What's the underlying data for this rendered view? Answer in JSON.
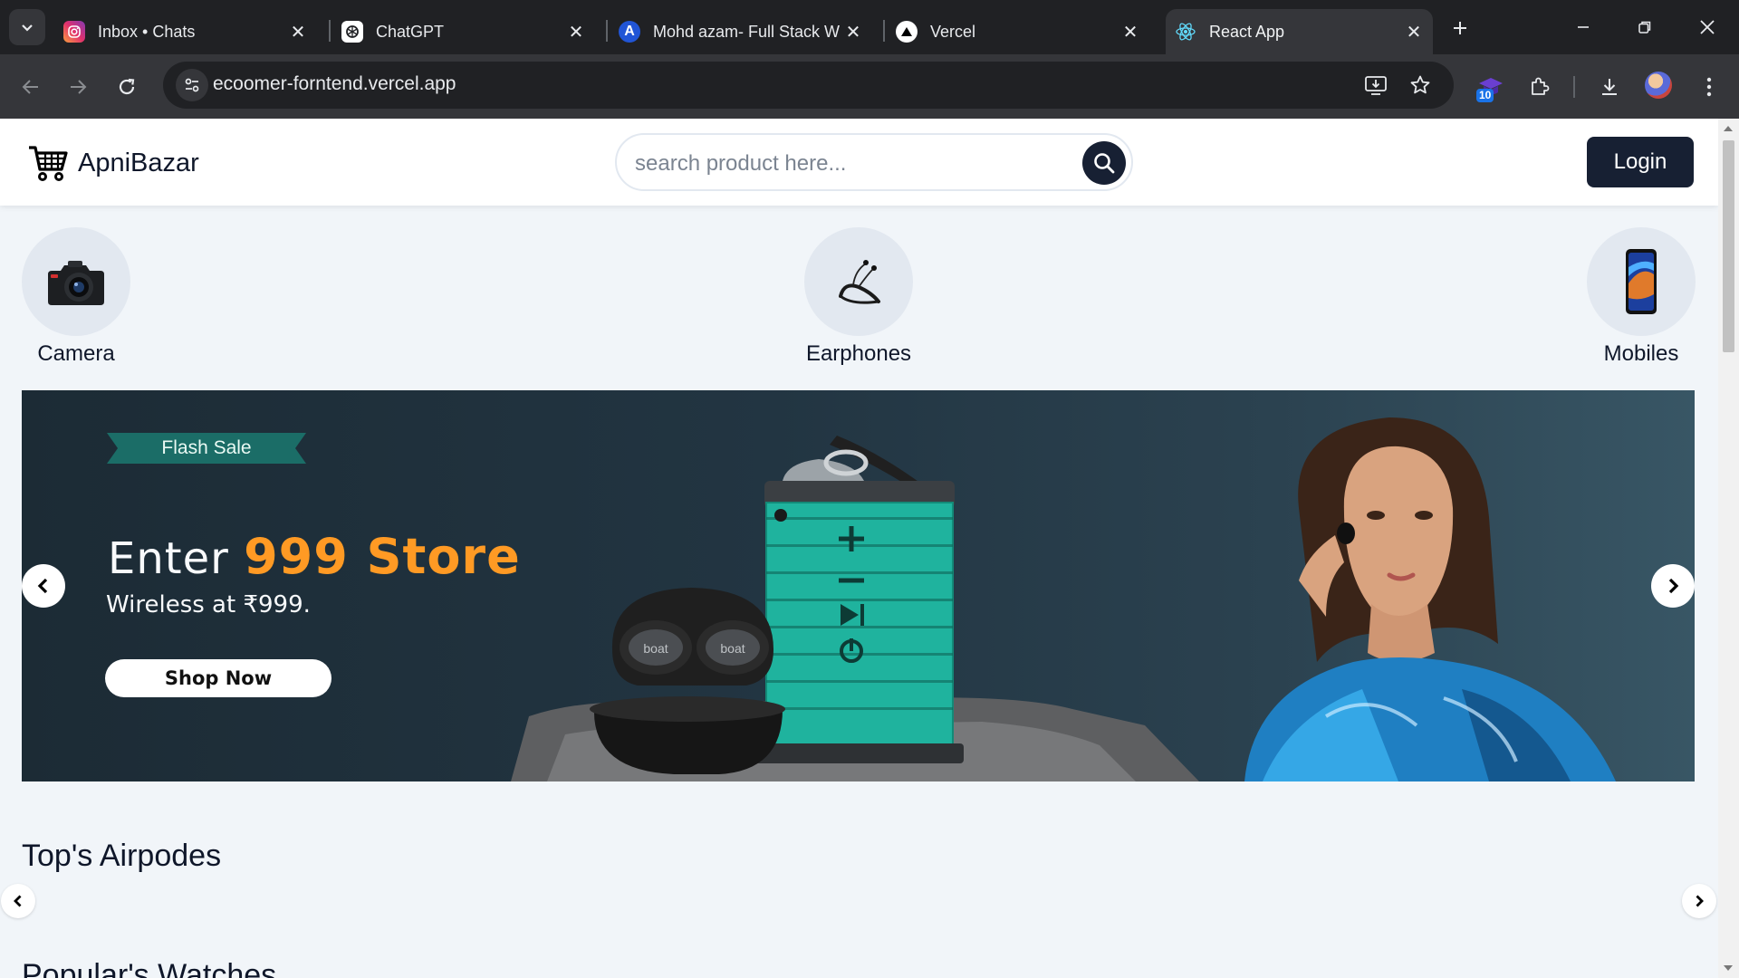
{
  "browser": {
    "tabs": [
      {
        "title": "Inbox • Chats",
        "icon": "instagram-icon"
      },
      {
        "title": "ChatGPT",
        "icon": "chatgpt-icon"
      },
      {
        "title": "Mohd azam- Full Stack W",
        "icon": "letter-a-icon"
      },
      {
        "title": "Vercel",
        "icon": "vercel-triangle-icon"
      },
      {
        "title": "React App",
        "icon": "react-icon",
        "active": true
      }
    ],
    "url": "ecoomer-forntend.vercel.app",
    "extension_badge": "10"
  },
  "header": {
    "logo_text": "ApniBazar",
    "search_placeholder": "search product here...",
    "login_label": "Login"
  },
  "categories": [
    {
      "label": "Camera",
      "icon": "camera-icon"
    },
    {
      "label": "Earphones",
      "icon": "neckband-earphones-icon"
    },
    {
      "label": "Mobiles",
      "icon": "smartphone-icon"
    }
  ],
  "banner": {
    "tag": "Flash Sale",
    "headline_prefix": "Enter",
    "headline_highlight": "999 Store",
    "subline": "Wireless at ₹999.",
    "cta": "Shop Now",
    "earbud_brand": "boat",
    "colors": {
      "tag": "#1b6d67",
      "highlight": "#ff9a24",
      "speaker": "#1fb39e"
    }
  },
  "sections": [
    {
      "title": "Top's Airpodes"
    },
    {
      "title": "Popular's Watches"
    }
  ]
}
